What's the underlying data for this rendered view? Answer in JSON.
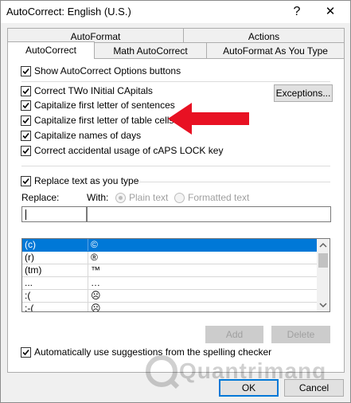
{
  "window": {
    "title": "AutoCorrect: English (U.S.)",
    "help_glyph": "?",
    "close_glyph": "✕"
  },
  "tabs": {
    "row1": [
      "AutoFormat",
      "Actions"
    ],
    "row2": [
      "AutoCorrect",
      "Math AutoCorrect",
      "AutoFormat As You Type"
    ],
    "active": "AutoCorrect"
  },
  "options": {
    "show_buttons": "Show AutoCorrect Options buttons",
    "two_initial": "Correct TWo INitial CApitals",
    "first_sentence": "Capitalize first letter of sentences",
    "first_table": "Capitalize first letter of table cells",
    "day_names": "Capitalize names of days",
    "caps_lock": "Correct accidental usage of cAPS LOCK key",
    "exceptions_button": "Exceptions..."
  },
  "replace": {
    "replace_as_you_type": "Replace text as you type",
    "replace_label": "Replace:",
    "with_label": "With:",
    "plain_text": "Plain text",
    "formatted_text": "Formatted text",
    "replace_value": "",
    "with_value": ""
  },
  "list": {
    "rows": [
      {
        "from": "(c)",
        "to": "©"
      },
      {
        "from": "(r)",
        "to": "®"
      },
      {
        "from": "(tm)",
        "to": "™"
      },
      {
        "from": "...",
        "to": "…"
      },
      {
        "from": ":(",
        "to": "☹"
      },
      {
        "from": ":-(",
        "to": "☹"
      }
    ],
    "selected_index": 0
  },
  "buttons": {
    "add": "Add",
    "delete": "Delete",
    "ok": "OK",
    "cancel": "Cancel"
  },
  "spelling": {
    "auto_suggest": "Automatically use suggestions from the spelling checker"
  },
  "watermark": {
    "text": "Quantrimang"
  },
  "colors": {
    "accent": "#0078d7",
    "annotation_arrow": "#e81123"
  },
  "icons": {
    "checkbox": "check-mark-icon",
    "arrow": "red-arrow-annotation-icon"
  }
}
